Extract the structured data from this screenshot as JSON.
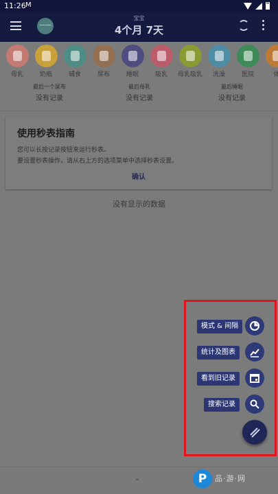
{
  "status_bar": {
    "time": "11:26",
    "m_glyph": "M"
  },
  "app_bar": {
    "subtitle": "宝宝",
    "title": "4个月 7天",
    "avatar_text": "一一"
  },
  "categories": [
    {
      "label": "母乳",
      "color": "#c27a73"
    },
    {
      "label": "奶瓶",
      "color": "#c8a13b"
    },
    {
      "label": "辅食",
      "color": "#4d8d85"
    },
    {
      "label": "尿布",
      "color": "#937052"
    },
    {
      "label": "睡眠",
      "color": "#4f4c80"
    },
    {
      "label": "吸乳",
      "color": "#bb5c6a"
    },
    {
      "label": "母乳吸乳",
      "color": "#8a9a35"
    },
    {
      "label": "洗澡",
      "color": "#4f8da5"
    },
    {
      "label": "医院",
      "color": "#3e8a58"
    },
    {
      "label": "体",
      "color": "#bb7a36"
    }
  ],
  "last_records": [
    {
      "heading": "最后一个尿布",
      "value": "没有记录"
    },
    {
      "heading": "最后母乳",
      "value": "没有记录"
    },
    {
      "heading": "最后睡眠",
      "value": "没有记录"
    }
  ],
  "guide": {
    "title": "使用秒表指南",
    "line1": "您可以长按记录按钮来运行秒表。",
    "line2": "要设置秒表操作，请从右上方的选项菜单中选择秒表设置。",
    "confirm": "确认"
  },
  "empty_message": "没有显示的数据",
  "fab_menu": [
    {
      "label": "模式 & 间隔",
      "icon": "pie-chart-icon"
    },
    {
      "label": "统计及图表",
      "icon": "trend-chart-icon"
    },
    {
      "label": "看到旧记录",
      "icon": "calendar-icon"
    },
    {
      "label": "搜索记录",
      "icon": "search-icon"
    }
  ],
  "watermark": {
    "logo": "P",
    "text": "品·游·网"
  },
  "colors": {
    "appbar": "#141a40",
    "fab": "#2e3a78",
    "highlight": "#e3131b"
  }
}
